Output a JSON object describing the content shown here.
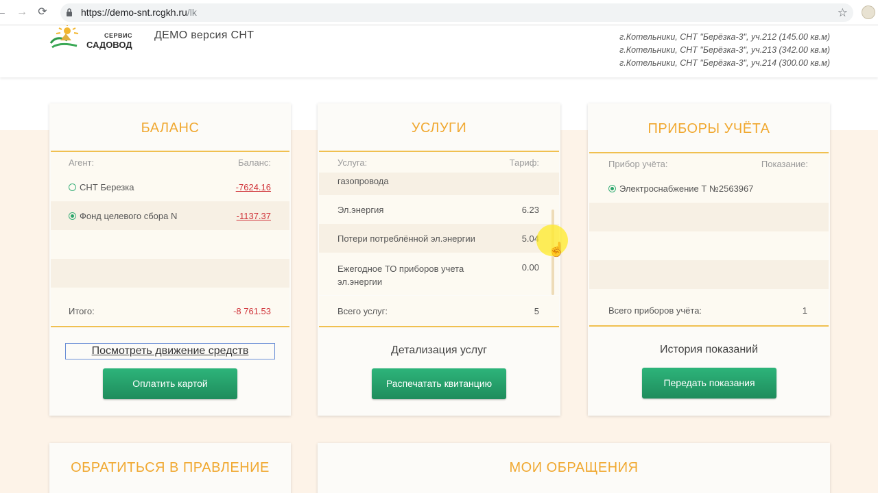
{
  "browser": {
    "url_host": "https://demo-snt.rcgkh.ru",
    "url_path": "/lk"
  },
  "header": {
    "logo_service": "СЕРВИС",
    "logo_name": "САДОВОД",
    "demo_title": "ДЕМО версия СНТ",
    "addresses": [
      "г.Котельники, СНТ \"Берёзка-3\", уч.212 (145.00 кв.м)",
      "г.Котельники, СНТ \"Берёзка-3\", уч.213 (342.00 кв.м)",
      "г.Котельники, СНТ \"Берёзка-3\", уч.214 (300.00 кв.м)"
    ]
  },
  "balance": {
    "title": "БАЛАНС",
    "col_agent": "Агент:",
    "col_balance": "Баланс:",
    "rows": [
      {
        "agent": "СНТ Березка",
        "balance": "-7624.16",
        "selected": false
      },
      {
        "agent": "Фонд целевого сбора N",
        "balance": "-1137.37",
        "selected": true
      }
    ],
    "total_label": "Итого:",
    "total_value": "-8 761.53",
    "movement_link": "Посмотреть движение средств",
    "pay_button": "Оплатить картой"
  },
  "services": {
    "title": "УСЛУГИ",
    "col_service": "Услуга:",
    "col_tariff": "Тариф:",
    "partial_row": "газопровода",
    "rows": [
      {
        "name": "Эл.энергия",
        "tariff": "6.23"
      },
      {
        "name": "Потери потреблённой эл.энергии",
        "tariff": "5.04"
      },
      {
        "name": "Ежегодное ТО приборов учета эл.энергии",
        "tariff": "0.00"
      }
    ],
    "total_label": "Всего услуг:",
    "total_value": "5",
    "details_link": "Детализация услуг",
    "print_button": "Распечатать квитанцию"
  },
  "meters": {
    "title": "ПРИБОРЫ УЧЁТА",
    "col_meter": "Прибор учёта:",
    "col_reading": "Показание:",
    "rows": [
      {
        "name": "Электроснабжение Т №2563967",
        "selected": true
      }
    ],
    "total_label": "Всего приборов учёта:",
    "total_value": "1",
    "history_link": "История показаний",
    "submit_button": "Передать показания"
  },
  "bottom": {
    "contact_title": "ОБРАТИТЬСЯ В ПРАВЛЕНИЕ",
    "requests_title": "МОИ ОБРАЩЕНИЯ"
  }
}
